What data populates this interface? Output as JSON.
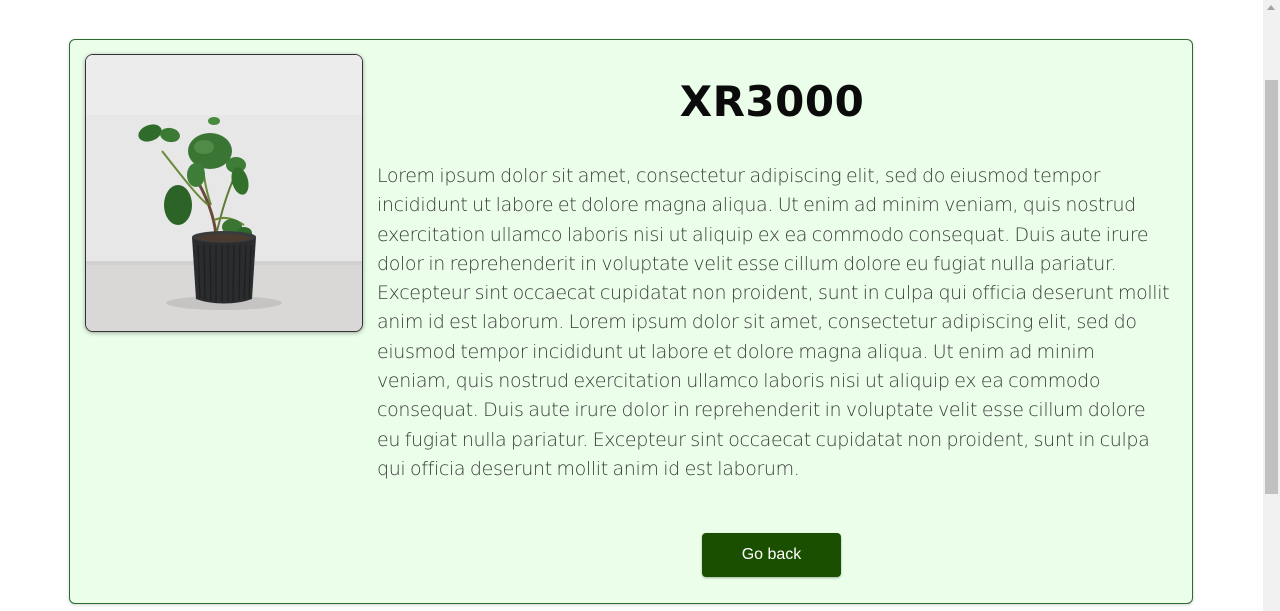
{
  "product": {
    "title": "XR3000",
    "image_alt": "Potted plant in a black ribbed pot",
    "description": "Lorem ipsum dolor sit amet, consectetur adipiscing elit, sed do eiusmod tempor incididunt ut labore et dolore magna aliqua. Ut enim ad minim veniam, quis nostrud exercitation ullamco laboris nisi ut aliquip ex ea commodo consequat. Duis aute irure dolor in reprehenderit in voluptate velit esse cillum dolore eu fugiat nulla pariatur. Excepteur sint occaecat cupidatat non proident, sunt in culpa qui officia deserunt mollit anim id est laborum. Lorem ipsum dolor sit amet, consectetur adipiscing elit, sed do eiusmod tempor incididunt ut labore et dolore magna aliqua. Ut enim ad minim veniam, quis nostrud exercitation ullamco laboris nisi ut aliquip ex ea commodo consequat. Duis aute irure dolor in reprehenderit in voluptate velit esse cillum dolore eu fugiat nulla pariatur. Excepteur sint occaecat cupidatat non proident, sunt in culpa qui officia deserunt mollit anim id est laborum."
  },
  "actions": {
    "back_label": "Go back"
  },
  "colors": {
    "card_background": "#eafeea",
    "card_border": "#2e6b2e",
    "button_background": "#1a4f00",
    "button_text": "#ffffff"
  }
}
